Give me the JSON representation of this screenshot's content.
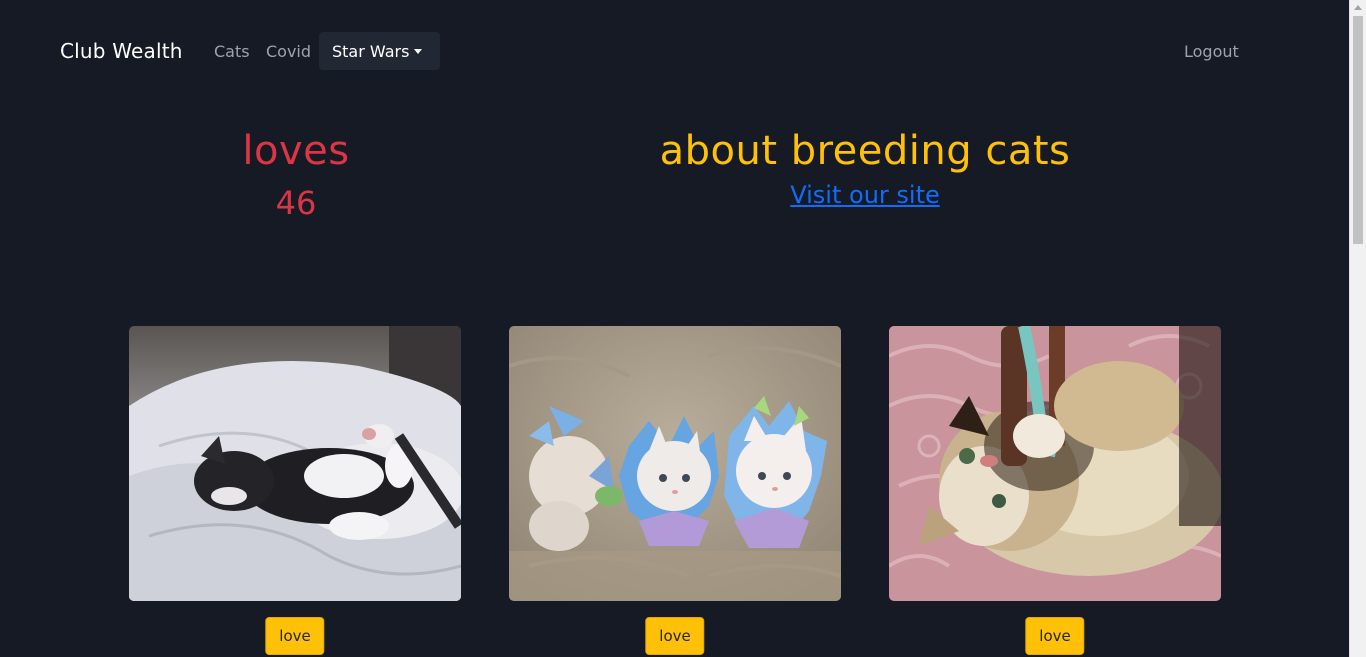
{
  "nav": {
    "brand": "Club Wealth",
    "links": {
      "cats": "Cats",
      "covid": "Covid"
    },
    "dropdown_label": "Star Wars",
    "logout": "Logout"
  },
  "hero": {
    "loves_title": "loves",
    "loves_count": "46",
    "about_title": "about breeding cats",
    "visit_link": "Visit our site"
  },
  "cards": [
    {
      "image": "kitten-sleeping-on-bed",
      "button_label": "love"
    },
    {
      "image": "three-kittens-in-flower-collars",
      "button_label": "love"
    },
    {
      "image": "kitten-playing-with-toy",
      "button_label": "love"
    }
  ],
  "colors": {
    "background": "#161a25",
    "loves": "#dc3545",
    "accent": "#ffc107",
    "link": "#0d6efd",
    "nav_link": "#9da3ab"
  }
}
